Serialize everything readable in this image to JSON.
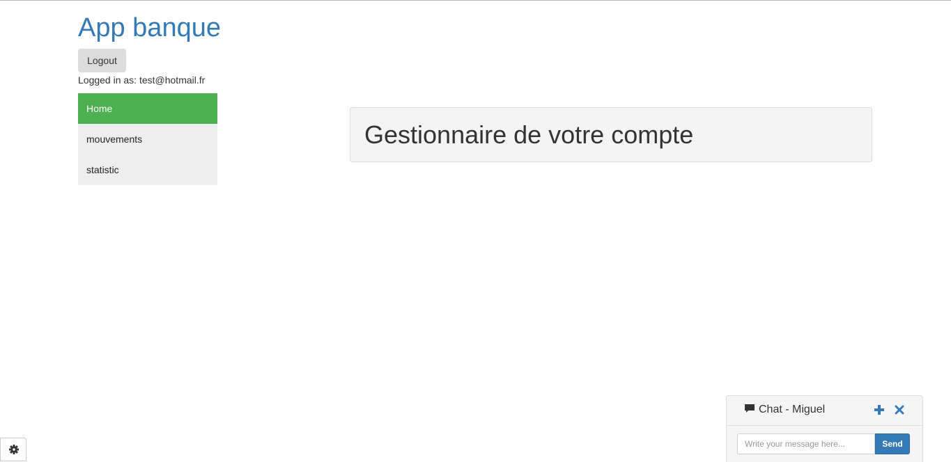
{
  "app": {
    "title": "App banque"
  },
  "header": {
    "logout_label": "Logout",
    "logged_in_text": "Logged in as: test@hotmail.fr"
  },
  "nav": {
    "items": [
      {
        "label": "Home",
        "active": true
      },
      {
        "label": "mouvements",
        "active": false
      },
      {
        "label": "statistic",
        "active": false
      }
    ]
  },
  "main": {
    "heading": "Gestionnaire de votre compte"
  },
  "chat": {
    "title": "Chat - Miguel",
    "input_placeholder": "Write your message here...",
    "send_label": "Send",
    "icons": [
      "comment-icon",
      "plus-icon",
      "close-icon"
    ]
  },
  "settings": {
    "icon": "gear-icon"
  },
  "colors": {
    "brand": "#337ab7",
    "nav_active": "#4caf50",
    "nav_bg": "#eeeeee",
    "send_button": "#337ab7"
  }
}
